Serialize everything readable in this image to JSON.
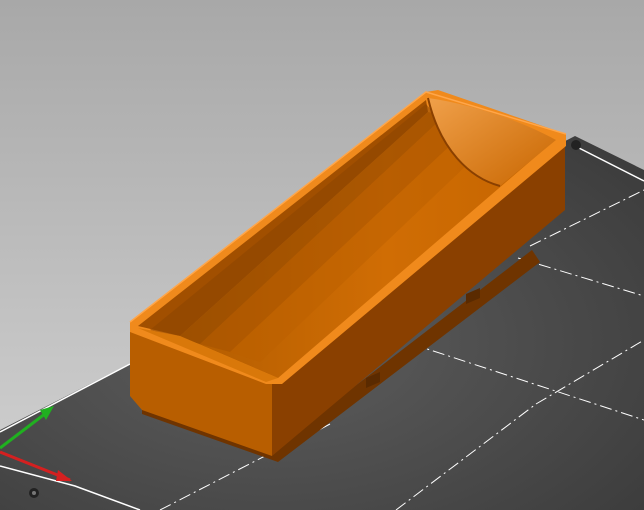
{
  "viewport": {
    "mode": "3d-preview",
    "background_top": "#a8a8a8",
    "background_bottom": "#d2d2d2"
  },
  "bed": {
    "surface_color": "#3c3c3c",
    "surface_light": "#5e5e5e",
    "edge_color": "#ffffff",
    "grid_line_color": "#ffffff",
    "grid_style": "dash-dot",
    "screw_color": "#222222"
  },
  "model": {
    "shape": "rectangular-tray-with-scoop",
    "color_main": "#cc6a00",
    "color_light": "#e07d12",
    "color_dark": "#8a4000",
    "color_rim": "#f08a1c"
  },
  "axes": {
    "x_color": "#d42020",
    "y_color": "#20b020",
    "z_color": "#2040d0"
  }
}
